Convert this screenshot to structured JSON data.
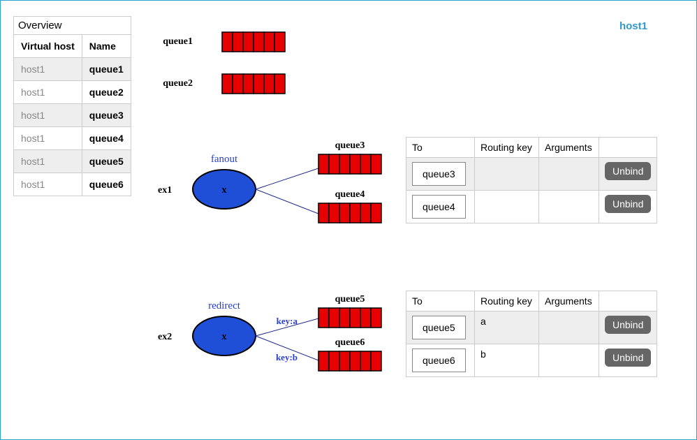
{
  "host_label": "host1",
  "overview": {
    "title": "Overview",
    "col_vhost": "Virtual host",
    "col_name": "Name",
    "rows": [
      {
        "vhost": "host1",
        "name": "queue1"
      },
      {
        "vhost": "host1",
        "name": "queue2"
      },
      {
        "vhost": "host1",
        "name": "queue3"
      },
      {
        "vhost": "host1",
        "name": "queue4"
      },
      {
        "vhost": "host1",
        "name": "queue5"
      },
      {
        "vhost": "host1",
        "name": "queue6"
      }
    ]
  },
  "diagram": {
    "standalone": [
      {
        "name": "queue1"
      },
      {
        "name": "queue2"
      }
    ],
    "exchanges": [
      {
        "label": "ex1",
        "type": "fanout",
        "x_char": "x",
        "bound_queues": [
          {
            "name": "queue3",
            "key": ""
          },
          {
            "name": "queue4",
            "key": ""
          }
        ]
      },
      {
        "label": "ex2",
        "type": "redirect",
        "x_char": "x",
        "bound_queues": [
          {
            "name": "queue5",
            "key": "key:a"
          },
          {
            "name": "queue6",
            "key": "key:b"
          }
        ]
      }
    ]
  },
  "bindings_header": {
    "to": "To",
    "routing_key": "Routing key",
    "arguments": "Arguments",
    "unbind": "Unbind"
  },
  "bindings_tables": [
    {
      "rows": [
        {
          "to": "queue3",
          "routing_key": "",
          "arguments": ""
        },
        {
          "to": "queue4",
          "routing_key": "",
          "arguments": ""
        }
      ]
    },
    {
      "rows": [
        {
          "to": "queue5",
          "routing_key": "a",
          "arguments": ""
        },
        {
          "to": "queue6",
          "routing_key": "b",
          "arguments": ""
        }
      ]
    }
  ]
}
